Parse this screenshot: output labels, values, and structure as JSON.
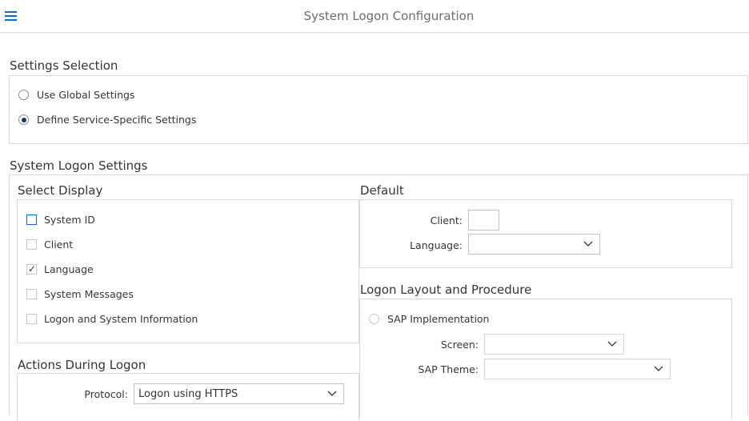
{
  "header": {
    "title": "System Logon Configuration"
  },
  "settings_selection": {
    "title": "Settings Selection",
    "options": [
      {
        "label": "Use Global Settings",
        "selected": false
      },
      {
        "label": "Define Service-Specific Settings",
        "selected": true
      }
    ]
  },
  "system_logon_settings": {
    "title": "System Logon Settings",
    "select_display": {
      "title": "Select Display",
      "items": [
        {
          "label": "System ID",
          "checked": false
        },
        {
          "label": "Client",
          "checked": false
        },
        {
          "label": "Language",
          "checked": true
        },
        {
          "label": "System Messages",
          "checked": false
        },
        {
          "label": "Logon and System Information",
          "checked": false
        }
      ]
    },
    "default": {
      "title": "Default",
      "client_label": "Client:",
      "client_value": "",
      "language_label": "Language:",
      "language_value": ""
    },
    "actions": {
      "title": "Actions During Logon",
      "protocol_label": "Protocol:",
      "protocol_value": "Logon using HTTPS"
    },
    "layout": {
      "title": "Logon Layout and Procedure",
      "sap_impl_label": "SAP Implementation",
      "screen_label": "Screen:",
      "screen_value": "",
      "theme_label": "SAP Theme:",
      "theme_value": ""
    }
  }
}
